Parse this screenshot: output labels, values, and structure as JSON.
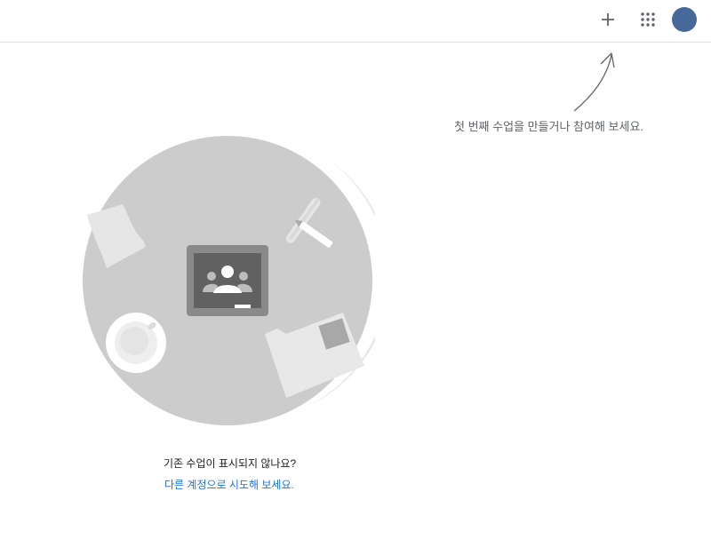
{
  "header": {
    "add_icon": "plus-icon",
    "apps_icon": "apps-grid-icon",
    "avatar_color": "#47699a"
  },
  "hint": {
    "text": "첫 번째 수업을 만들거나 참여해 보세요."
  },
  "empty_state": {
    "illustration": "classroom-illustration",
    "question": "기존 수업이 표시되지 않나요?",
    "switch_account_link": "다른 계정으로 시도해 보세요."
  },
  "colors": {
    "link": "#1a73e8",
    "text_secondary": "#5f6368",
    "divider": "#e0e0e0"
  }
}
